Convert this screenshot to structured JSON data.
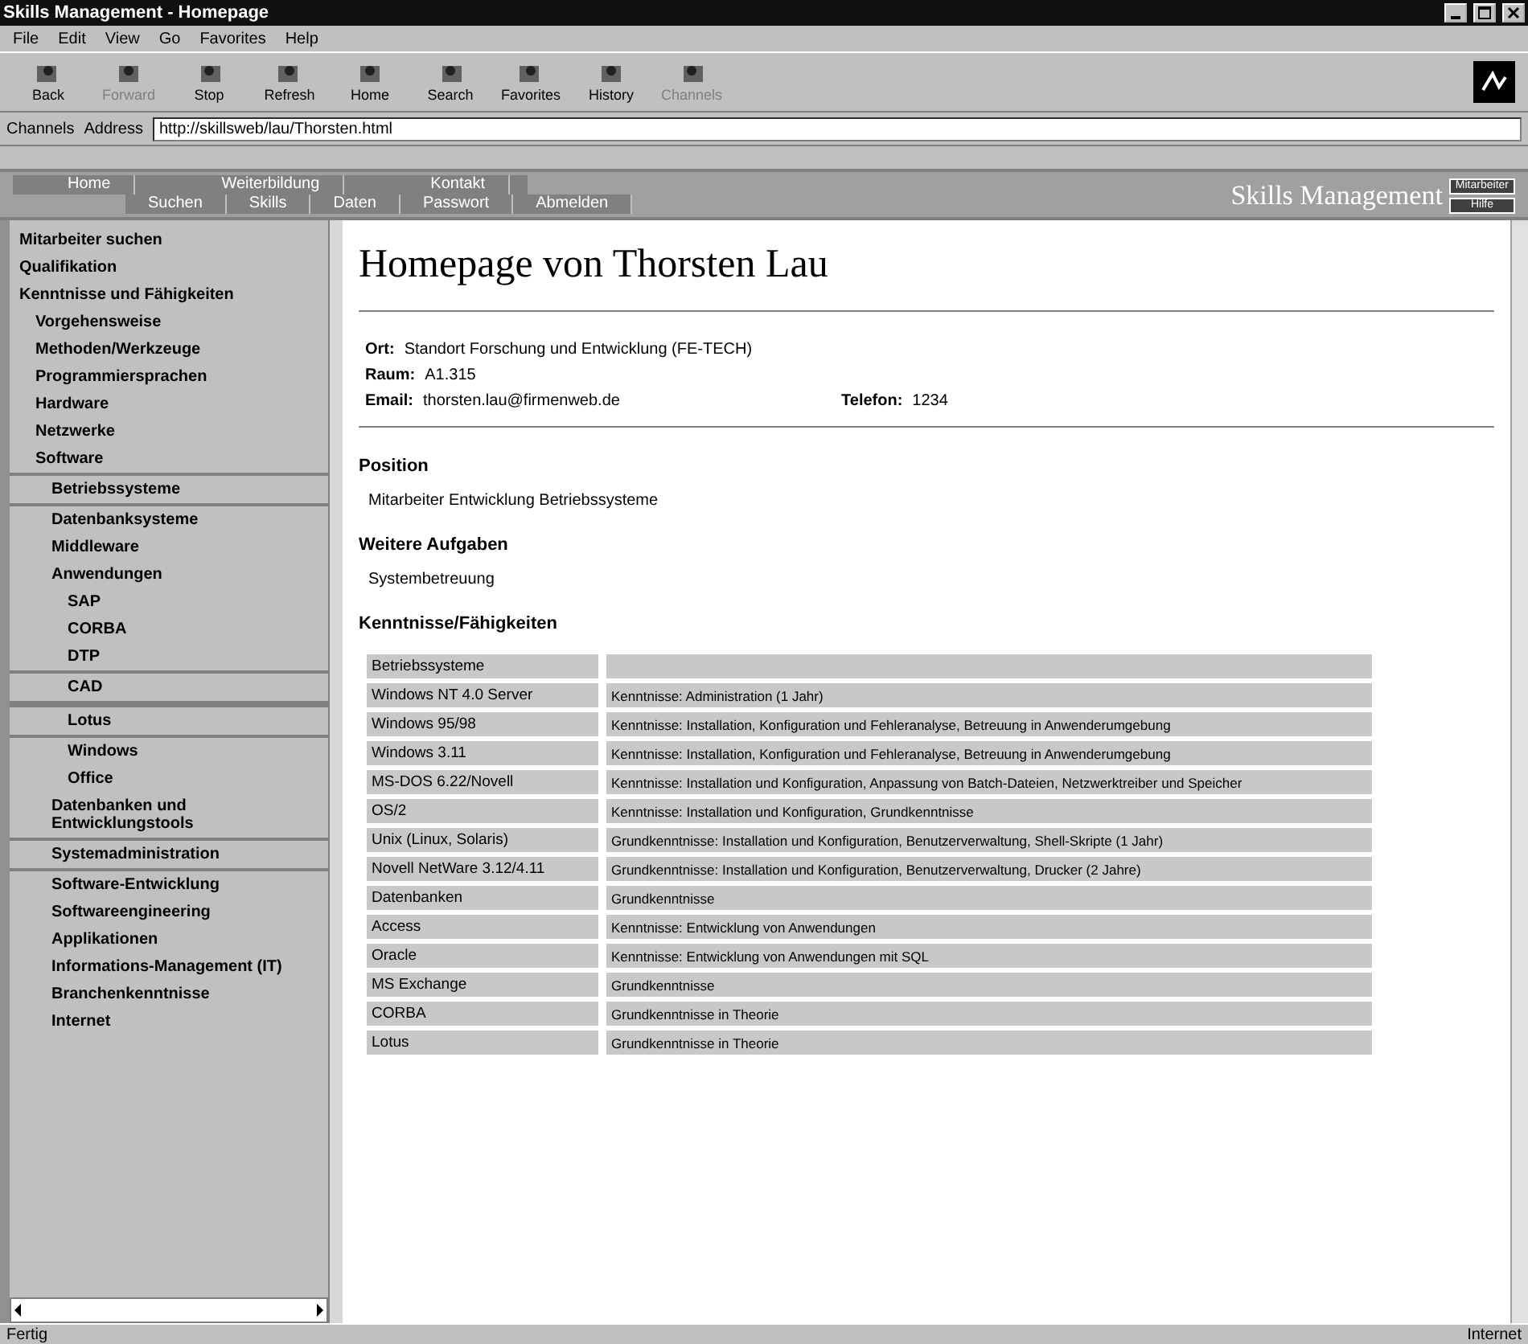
{
  "window": {
    "title": "Skills Management - Homepage"
  },
  "menu": [
    "File",
    "Edit",
    "View",
    "Go",
    "Favorites",
    "Help"
  ],
  "toolbar": [
    {
      "label": "Back",
      "disabled": false
    },
    {
      "label": "Forward",
      "disabled": true
    },
    {
      "label": "Stop",
      "disabled": false
    },
    {
      "label": "Refresh",
      "disabled": false
    },
    {
      "label": "Home",
      "disabled": false
    },
    {
      "label": "Search",
      "disabled": false
    },
    {
      "label": "Favorites",
      "disabled": false
    },
    {
      "label": "History",
      "disabled": false
    },
    {
      "label": "Channels",
      "disabled": true
    }
  ],
  "address_bar": {
    "links_label": "Channels",
    "address_label": "Address",
    "value": "http://skillsweb/lau/Thorsten.html"
  },
  "nav": {
    "top": [
      "Home",
      "Weiterbildung",
      "Kontakt"
    ],
    "bottom": [
      "Suchen",
      "Skills",
      "Daten",
      "Passwort",
      "Abmelden"
    ],
    "logo": "Skills Management",
    "buttons": [
      "Mitarbeiter",
      "Hilfe"
    ]
  },
  "sidebar": {
    "items": [
      {
        "label": "Mitarbeiter suchen",
        "highlighted": false
      },
      {
        "label": "Qualifikation",
        "highlighted": false
      },
      {
        "label": "Kenntnisse und Fähigkeiten",
        "highlighted": false,
        "children": [
          {
            "label": "Vorgehensweise",
            "highlighted": false
          },
          {
            "label": "Methoden/Werkzeuge",
            "highlighted": false
          },
          {
            "label": "Programmiersprachen",
            "highlighted": false
          },
          {
            "label": "Hardware",
            "highlighted": false
          },
          {
            "label": "Netzwerke",
            "highlighted": false
          },
          {
            "label": "Software",
            "highlighted": false,
            "children": [
              {
                "label": "Betriebssysteme",
                "highlighted": true
              },
              {
                "label": "Datenbanksysteme",
                "highlighted": false
              },
              {
                "label": "Middleware",
                "highlighted": false
              },
              {
                "label": "Anwendungen",
                "highlighted": false,
                "children": [
                  {
                    "label": "SAP",
                    "highlighted": false
                  },
                  {
                    "label": "CORBA",
                    "highlighted": false
                  },
                  {
                    "label": "DTP",
                    "highlighted": false
                  },
                  {
                    "label": "CAD",
                    "highlighted": true
                  },
                  {
                    "label": "Lotus",
                    "highlighted": true
                  },
                  {
                    "label": "Windows",
                    "highlighted": false
                  },
                  {
                    "label": "Office",
                    "highlighted": false
                  }
                ]
              },
              {
                "label": "Datenbanken und Entwicklungstools",
                "highlighted": false
              },
              {
                "label": "Systemadministration",
                "highlighted": true
              },
              {
                "label": "Software-Entwicklung",
                "highlighted": false
              },
              {
                "label": "Softwareengineering",
                "highlighted": false
              },
              {
                "label": "Applikationen",
                "highlighted": false
              },
              {
                "label": "Informations-Management (IT)",
                "highlighted": false
              },
              {
                "label": "Branchenkenntnisse",
                "highlighted": false
              },
              {
                "label": "Internet",
                "highlighted": false
              }
            ]
          }
        ]
      }
    ]
  },
  "page": {
    "title": "Homepage von Thorsten Lau",
    "fields": [
      {
        "label": "Ort:",
        "value": "Standort Forschung und Entwicklung (FE-TECH)"
      },
      {
        "label": "Raum:",
        "value": "A1.315"
      },
      {
        "label": "Email:",
        "value": "thorsten.lau@firmenweb.de",
        "extra_label": "Telefon:",
        "extra_value": "1234"
      }
    ],
    "sections": [
      {
        "heading": "Position",
        "text": "Mitarbeiter Entwicklung Betriebssysteme"
      },
      {
        "heading": "Weitere Aufgaben",
        "text": "Systembetreuung"
      }
    ],
    "skills_heading": "Kenntnisse/Fähigkeiten",
    "skills": [
      [
        "Betriebssysteme"
      ],
      [
        "Windows NT 4.0 Server",
        "Kenntnisse: Administration (1 Jahr)"
      ],
      [
        "Windows 95/98",
        "Kenntnisse: Installation, Konfiguration und Fehleranalyse, Betreuung in Anwenderumgebung"
      ],
      [
        "Windows 3.11",
        "Kenntnisse: Installation, Konfiguration und Fehleranalyse, Betreuung in Anwenderumgebung"
      ],
      [
        "MS-DOS 6.22/Novell",
        "Kenntnisse: Installation und Konfiguration, Anpassung von Batch-Dateien, Netzwerktreiber und Speicher"
      ],
      [
        "OS/2",
        "Kenntnisse: Installation und Konfiguration, Grundkenntnisse"
      ],
      [
        "Unix (Linux, Solaris)",
        "Grundkenntnisse: Installation und Konfiguration, Benutzerverwaltung, Shell-Skripte (1 Jahr)"
      ],
      [
        "Novell NetWare 3.12/4.11",
        "Grundkenntnisse: Installation und Konfiguration, Benutzerverwaltung, Drucker (2 Jahre)"
      ],
      [
        "Datenbanken",
        "Grundkenntnisse"
      ],
      [
        "Access",
        "Kenntnisse: Entwicklung von Anwendungen"
      ],
      [
        "Oracle",
        "Kenntnisse: Entwicklung von Anwendungen mit SQL"
      ],
      [
        "MS Exchange",
        "Grundkenntnisse"
      ],
      [
        "CORBA",
        "Grundkenntnisse in Theorie"
      ],
      [
        "Lotus",
        "Grundkenntnisse in Theorie"
      ]
    ]
  },
  "status_bar": {
    "text": "Fertig",
    "zone": "Internet"
  }
}
